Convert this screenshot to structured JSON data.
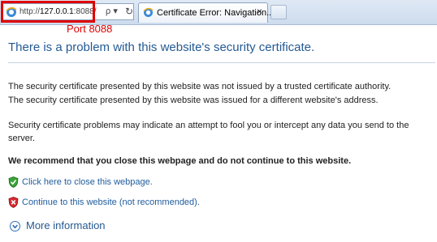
{
  "browser": {
    "url_prefix": "http://",
    "url_host": "127.0.0.1",
    "url_suffix": ":8088/",
    "tab_title": "Certificate Error: Navigation...",
    "tab_close": "×",
    "search_dropdown": "ρ ▾",
    "refresh": "↻"
  },
  "annotation": {
    "text": "Port 8088",
    "color": "#e00000"
  },
  "page": {
    "title": "There is a problem with this website's security certificate.",
    "paragraphs": [
      "The security certificate presented by this website was not issued by a trusted certificate authority.",
      "The security certificate presented by this website was issued for a different website's address.",
      "Security certificate problems may indicate an attempt to fool you or intercept any data you send to the server."
    ],
    "recommendation": "We recommend that you close this webpage and do not continue to this website.",
    "close_link": "Click here to close this webpage.",
    "continue_link": "Continue to this website (not recommended).",
    "more_info": "More information"
  },
  "icons": {
    "close_action": "green-shield-check-icon",
    "continue_action": "red-shield-x-icon",
    "more_info": "chevron-down-circle-icon"
  },
  "colors": {
    "title_blue": "#245a93",
    "link_blue": "#1f5b9c",
    "highlight_red": "#e00000"
  }
}
